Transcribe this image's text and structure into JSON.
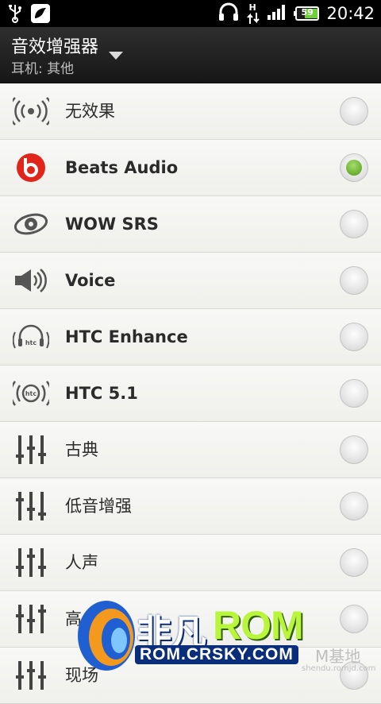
{
  "status": {
    "time": "20:42",
    "battery": "59",
    "network_type": "H",
    "icons": [
      "usb-icon",
      "notification-icon",
      "headset-icon",
      "data-transfer-icon",
      "signal-icon",
      "battery-icon"
    ]
  },
  "header": {
    "title": "音效增强器",
    "subtitle": "耳机: 其他"
  },
  "items": [
    {
      "label": "无效果",
      "icon": "surround-icon",
      "selected": false
    },
    {
      "label": "Beats Audio",
      "icon": "beats-logo-icon",
      "selected": true
    },
    {
      "label": "WOW SRS",
      "icon": "srs-logo-icon",
      "selected": false
    },
    {
      "label": "Voice",
      "icon": "speaker-icon",
      "selected": false
    },
    {
      "label": "HTC Enhance",
      "icon": "htc-enhance-icon",
      "selected": false
    },
    {
      "label": "HTC 5.1",
      "icon": "htc-51-icon",
      "selected": false
    },
    {
      "label": "古典",
      "icon": "equalizer-icon",
      "selected": false
    },
    {
      "label": "低音增强",
      "icon": "equalizer-icon",
      "selected": false
    },
    {
      "label": "人声",
      "icon": "equalizer-icon",
      "selected": false
    },
    {
      "label": "高",
      "icon": "equalizer-icon",
      "selected": false
    },
    {
      "label": "现场",
      "icon": "equalizer-icon",
      "selected": false
    }
  ],
  "watermark": {
    "brand_cn": "非凡",
    "brand_rom": "ROM",
    "url": "ROM.CRSKY.COM",
    "side_text": "M基地",
    "side_small": "shendu.romjd.com"
  },
  "colors": {
    "selected": "#6fb637",
    "statusbar": "#000000",
    "titlebar": "#222222",
    "background": "#f3f3f1"
  }
}
